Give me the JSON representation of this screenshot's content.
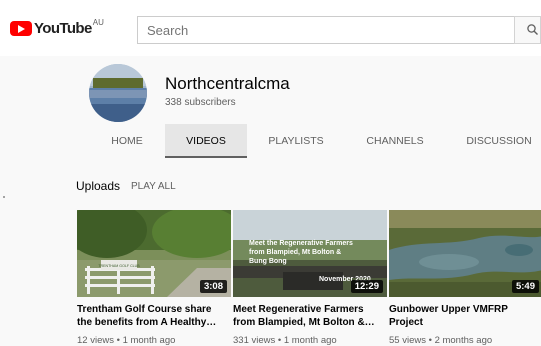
{
  "header": {
    "logo_text": "YouTube",
    "logo_region": "AU",
    "search_placeholder": "Search"
  },
  "channel": {
    "name": "Northcentralcma",
    "subscribers": "338 subscribers"
  },
  "tabs": [
    {
      "label": "HOME",
      "active": false
    },
    {
      "label": "VIDEOS",
      "active": true
    },
    {
      "label": "PLAYLISTS",
      "active": false
    },
    {
      "label": "CHANNELS",
      "active": false
    },
    {
      "label": "DISCUSSION",
      "active": false
    }
  ],
  "section": {
    "title": "Uploads",
    "play_all": "PLAY ALL"
  },
  "videos": [
    {
      "title": "Trentham Golf Course share the benefits from A Healthy…",
      "duration": "3:08",
      "meta": "12 views • 1 month ago",
      "thumb_sign": "TRENTHAM GOLF CLUB"
    },
    {
      "title": "Meet Regenerative Farmers from Blampied, Mt Bolton &…",
      "duration": "12:29",
      "meta": "331 views • 1 month ago",
      "thumb_overlay": "Meet the Regenerative Farmers from Blampied, Mt Bolton & Bung Bong",
      "thumb_date": "November 2020"
    },
    {
      "title": "Gunbower Upper VMFRP Project",
      "duration": "5:49",
      "meta": "55 views • 2 months ago"
    }
  ],
  "colors": {
    "brand_red": "#ff0000",
    "page_bg": "#f9f9f9",
    "secondary_text": "#606060"
  }
}
